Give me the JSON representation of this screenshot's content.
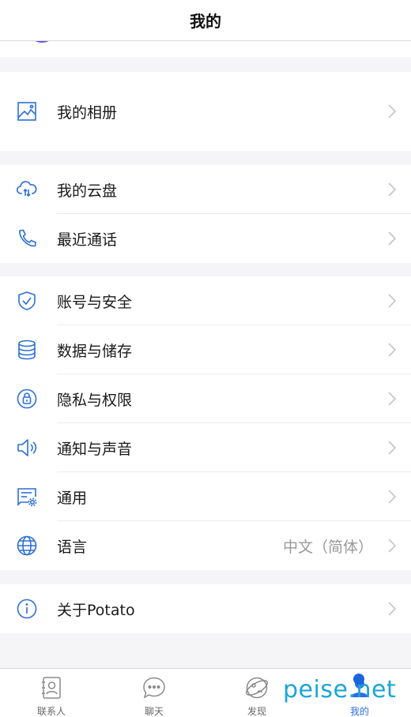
{
  "header": {
    "title": "我的"
  },
  "groups": [
    {
      "rows": [
        {
          "icon": "image-gallery-icon",
          "label": "我的相册"
        }
      ]
    },
    {
      "rows": [
        {
          "icon": "cloud-upload-icon",
          "label": "我的云盘"
        },
        {
          "icon": "phone-icon",
          "label": "最近通话"
        }
      ]
    },
    {
      "rows": [
        {
          "icon": "shield-check-icon",
          "label": "账号与安全"
        },
        {
          "icon": "database-icon",
          "label": "数据与储存"
        },
        {
          "icon": "lock-icon",
          "label": "隐私与权限"
        },
        {
          "icon": "speaker-icon",
          "label": "通知与声音"
        },
        {
          "icon": "settings-message-icon",
          "label": "通用"
        },
        {
          "icon": "globe-icon",
          "label": "语言",
          "value": "中文（简体）"
        }
      ]
    },
    {
      "rows": [
        {
          "icon": "info-icon",
          "label": "关于Potato"
        }
      ]
    }
  ],
  "tabbar": {
    "items": [
      {
        "icon": "contacts-icon",
        "label": "联系人",
        "active": false
      },
      {
        "icon": "chat-icon",
        "label": "聊天",
        "active": false
      },
      {
        "icon": "discover-icon",
        "label": "发现",
        "active": false
      },
      {
        "icon": "profile-icon",
        "label": "我的",
        "active": true
      }
    ]
  },
  "watermark": {
    "text": "peise.net"
  },
  "colors": {
    "accent": "#2e6ce6",
    "icon": "#2b6fd6",
    "background": "#f5f5f7",
    "value_text": "#9a9a9a"
  }
}
